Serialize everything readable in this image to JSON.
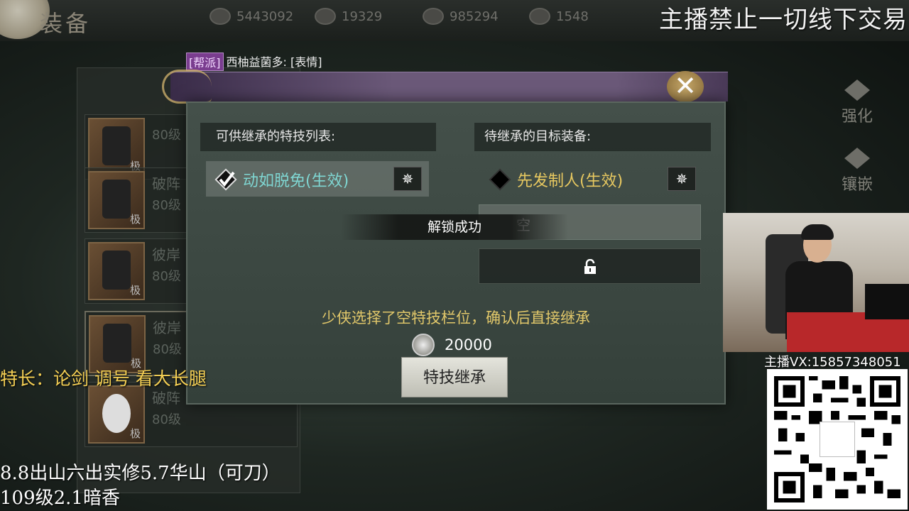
{
  "header": {
    "title": "装备",
    "currencies": [
      {
        "icon": "coin-icon",
        "value": "5443092"
      },
      {
        "icon": "ingot-icon",
        "value": "19329"
      },
      {
        "icon": "gem-icon",
        "value": "985294"
      },
      {
        "icon": "bowl-icon",
        "value": "1548"
      }
    ]
  },
  "overlay": {
    "notice": "主播禁止一切线下交易",
    "specialty": "特长：论剑 调号 看大长腿",
    "line1": "8.8出山六出实修5.7华山（可刀）",
    "line2": "109级2.1暗香",
    "vx": "主播VX:15857348051"
  },
  "chat": {
    "tag": "[帮派]",
    "message": "西柚益菌多: [表情]"
  },
  "equipment_list": [
    {
      "name": "",
      "level": "80级",
      "bind": "极"
    },
    {
      "name": "破阵",
      "level": "80级",
      "bind": "极"
    },
    {
      "name": "彼岸",
      "level": "80级",
      "bind": "极"
    },
    {
      "name": "彼岸",
      "level": "80级",
      "bind": "极"
    },
    {
      "name": "破阵",
      "level": "80级",
      "bind": "极"
    }
  ],
  "side_buttons": [
    {
      "icon": "hammer-icon",
      "label": "强化"
    },
    {
      "icon": "hexagon-icon",
      "label": "镶嵌"
    }
  ],
  "dialog": {
    "left_header": "可供继承的特技列表:",
    "right_header": "待继承的目标装备:",
    "left_skill": "动如脱免(生效)",
    "right_skill": "先发制人(生效)",
    "empty_slot": "空",
    "toast": "解锁成功",
    "hint": "少侠选择了空特技栏位，确认后直接继承",
    "cost": "20000",
    "confirm_label": "特技继承",
    "close_label": "✕"
  },
  "colors": {
    "left_skill": "#7fd6d2",
    "right_skill": "#e7c860",
    "hint": "#e2c86a",
    "overlay_yellow": "#f4cf54"
  }
}
